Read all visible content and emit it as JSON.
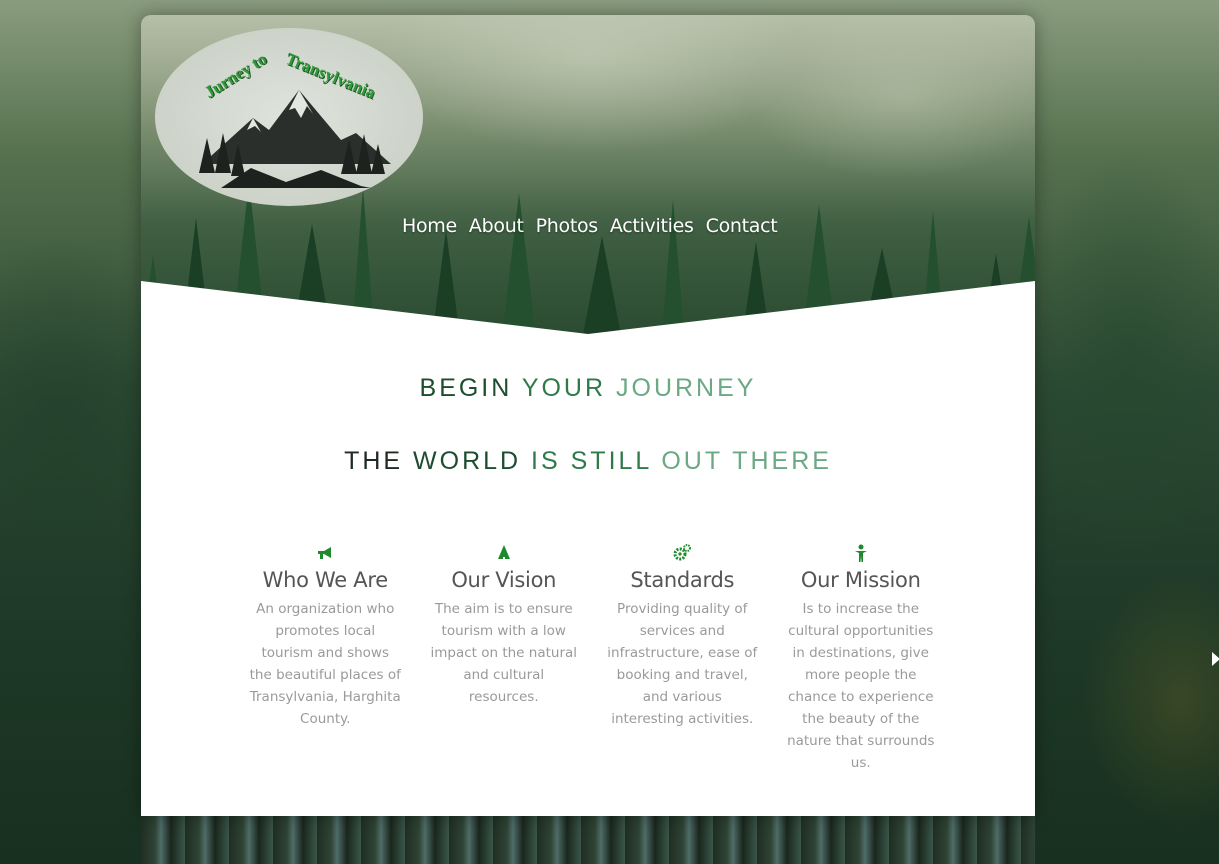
{
  "logo": {
    "text_line1": "Jurney to",
    "text_line2": "Transylvania",
    "icon": "mountain-forest-logo"
  },
  "nav": {
    "items": [
      {
        "label": "Home"
      },
      {
        "label": "About"
      },
      {
        "label": "Photos"
      },
      {
        "label": "Activities"
      },
      {
        "label": "Contact"
      }
    ]
  },
  "headline1": {
    "words": [
      "BEGIN",
      "YOUR",
      "JOURNEY"
    ]
  },
  "headline2": {
    "words": [
      "THE",
      "WORLD",
      "IS",
      "STILL",
      "OUT",
      "THERE"
    ]
  },
  "features": [
    {
      "icon": "megaphone-icon",
      "title": "Who We Are",
      "text": "An organization who promotes local tourism and shows the beautiful places of Transylvania, Harghita County."
    },
    {
      "icon": "tree-icon",
      "title": "Our Vision",
      "text": "The aim is to ensure tourism with a low impact on the natural and cultural resources."
    },
    {
      "icon": "gears-icon",
      "title": "Standards",
      "text": "Providing quality of services and infrastructure, ease of booking and travel, and various interesting activities."
    },
    {
      "icon": "person-icon",
      "title": "Our Mission",
      "text": "Is to increase the cultural opportunities in destinations, give more people the chance to experience the beauty of the nature that surrounds us."
    }
  ],
  "colors": {
    "accent_green": "#1f8a2c",
    "heading_dark": "#1c4d2e",
    "heading_mid": "#2f7a49",
    "heading_light": "#6ba884"
  }
}
